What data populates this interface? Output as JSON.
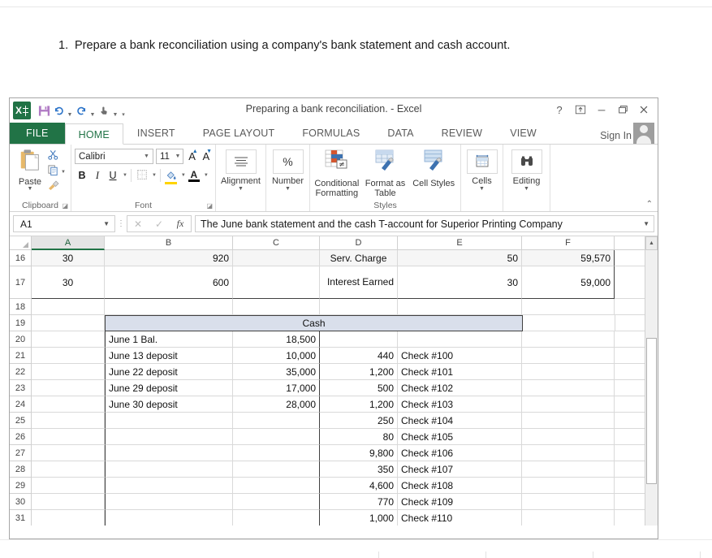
{
  "prompt": {
    "number": "1.",
    "text": "Prepare a bank reconciliation using a company's bank statement and cash account."
  },
  "window": {
    "title": "Preparing a bank reconciliation. - Excel",
    "help_icon": "?",
    "ribbon_display_icon": "ribbon-display-options-icon",
    "minimize_icon": "minimize-icon",
    "restore_icon": "restore-icon",
    "close_icon": "close-icon",
    "signin": "Sign In",
    "accent_green": "#217346"
  },
  "qat": {
    "logo": "excel-logo-icon",
    "save": "save-icon",
    "undo": "undo-icon",
    "redo": "redo-icon",
    "touch": "touch-mode-icon",
    "customize": "customize-quick-access-toolbar-icon"
  },
  "tabs": [
    {
      "label": "FILE",
      "active": false,
      "file": true
    },
    {
      "label": "HOME",
      "active": true,
      "file": false
    },
    {
      "label": "INSERT",
      "active": false,
      "file": false
    },
    {
      "label": "PAGE LAYOUT",
      "active": false,
      "file": false
    },
    {
      "label": "FORMULAS",
      "active": false,
      "file": false
    },
    {
      "label": "DATA",
      "active": false,
      "file": false
    },
    {
      "label": "REVIEW",
      "active": false,
      "file": false
    },
    {
      "label": "VIEW",
      "active": false,
      "file": false
    }
  ],
  "ribbon": {
    "clipboard": {
      "group_label": "Clipboard",
      "paste_label": "Paste",
      "cut_icon": "cut-scissors-icon",
      "copy_icon": "copy-icon",
      "format_painter_icon": "format-painter-icon",
      "dialog_launcher": "dialog-box-launcher-icon"
    },
    "font": {
      "group_label": "Font",
      "font_name": "Calibri",
      "font_size": "11",
      "grow_font": "A",
      "shrink_font": "A",
      "bold": "B",
      "italic": "I",
      "underline": "U",
      "borders_icon": "borders-icon",
      "fill_color_icon": "fill-color-icon",
      "font_color_icon": "font-color-icon",
      "dialog_launcher": "dialog-box-launcher-icon"
    },
    "alignment": {
      "label": "Alignment",
      "icon": "alignment-icon"
    },
    "number": {
      "label": "Number",
      "icon": "percent-icon"
    },
    "styles": {
      "group_label": "Styles",
      "items": [
        {
          "label": "Conditional Formatting",
          "icon": "conditional-formatting-icon"
        },
        {
          "label": "Format as Table",
          "icon": "format-as-table-icon"
        },
        {
          "label": "Cell Styles",
          "icon": "cell-styles-icon"
        }
      ]
    },
    "cells": {
      "label": "Cells",
      "icon": "cells-icon"
    },
    "editing": {
      "label": "Editing",
      "icon": "editing-binoculars-icon"
    },
    "collapse_icon": "collapse-ribbon-icon"
  },
  "formula_bar": {
    "name_box": "A1",
    "cancel_icon": "cancel-x-icon",
    "enter_icon": "enter-check-icon",
    "insert_function_icon": "fx",
    "formula": "The June bank statement and the cash T-account for Superior Printing Company",
    "expand_icon": "expand-formula-bar-icon"
  },
  "sheet": {
    "columns": [
      "A",
      "B",
      "C",
      "D",
      "E",
      "F",
      ""
    ],
    "selected_column": "A",
    "rows": [
      {
        "num": "16",
        "shaded": true,
        "cells": [
          {
            "col": "A",
            "value": "30",
            "align": "ctr"
          },
          {
            "col": "B",
            "value": "920",
            "align": "rgt"
          },
          {
            "col": "C",
            "value": "",
            "align": "lft"
          },
          {
            "col": "D",
            "value": "Serv. Charge",
            "align": "ctr"
          },
          {
            "col": "E",
            "value": "50",
            "align": "rgt"
          },
          {
            "col": "F",
            "value": "59,570",
            "align": "rgt"
          },
          {
            "col": "G",
            "value": "",
            "align": "lft"
          }
        ]
      },
      {
        "num": "17",
        "shaded": false,
        "cells": [
          {
            "col": "A",
            "value": "30",
            "align": "ctr"
          },
          {
            "col": "B",
            "value": "600",
            "align": "rgt"
          },
          {
            "col": "C",
            "value": "",
            "align": "lft"
          },
          {
            "col": "D",
            "value": "Interest Earned",
            "align": "wrap"
          },
          {
            "col": "E",
            "value": "30",
            "align": "rgt"
          },
          {
            "col": "F",
            "value": "59,000",
            "align": "rgt"
          },
          {
            "col": "G",
            "value": "",
            "align": "lft"
          }
        ]
      },
      {
        "num": "18",
        "shaded": false,
        "cells": [
          {
            "col": "A",
            "value": "",
            "align": "lft"
          },
          {
            "col": "B",
            "value": "",
            "align": "lft"
          },
          {
            "col": "C",
            "value": "",
            "align": "lft"
          },
          {
            "col": "D",
            "value": "",
            "align": "lft"
          },
          {
            "col": "E",
            "value": "",
            "align": "lft"
          },
          {
            "col": "F",
            "value": "",
            "align": "lft"
          },
          {
            "col": "G",
            "value": "",
            "align": "lft"
          }
        ]
      },
      {
        "num": "19",
        "shaded": false,
        "merged_label": "Cash",
        "cells": []
      },
      {
        "num": "20",
        "shaded": false,
        "cells": [
          {
            "col": "A",
            "value": "",
            "align": "lft"
          },
          {
            "col": "B",
            "value": "June 1 Bal.",
            "align": "lft"
          },
          {
            "col": "C",
            "value": "18,500",
            "align": "rgt"
          },
          {
            "col": "D",
            "value": "",
            "align": "rgt"
          },
          {
            "col": "E",
            "value": "",
            "align": "lft"
          },
          {
            "col": "F",
            "value": "",
            "align": "lft"
          },
          {
            "col": "G",
            "value": "",
            "align": "lft"
          }
        ]
      },
      {
        "num": "21",
        "shaded": false,
        "cells": [
          {
            "col": "A",
            "value": "",
            "align": "lft"
          },
          {
            "col": "B",
            "value": "June 13 deposit",
            "align": "lft"
          },
          {
            "col": "C",
            "value": "10,000",
            "align": "rgt"
          },
          {
            "col": "D",
            "value": "440",
            "align": "rgt"
          },
          {
            "col": "E",
            "value": "Check #100",
            "align": "lft"
          },
          {
            "col": "F",
            "value": "",
            "align": "lft"
          },
          {
            "col": "G",
            "value": "",
            "align": "lft"
          }
        ]
      },
      {
        "num": "22",
        "shaded": false,
        "cells": [
          {
            "col": "A",
            "value": "",
            "align": "lft"
          },
          {
            "col": "B",
            "value": "June 22 deposit",
            "align": "lft"
          },
          {
            "col": "C",
            "value": "35,000",
            "align": "rgt"
          },
          {
            "col": "D",
            "value": "1,200",
            "align": "rgt"
          },
          {
            "col": "E",
            "value": "Check #101",
            "align": "lft"
          },
          {
            "col": "F",
            "value": "",
            "align": "lft"
          },
          {
            "col": "G",
            "value": "",
            "align": "lft"
          }
        ]
      },
      {
        "num": "23",
        "shaded": false,
        "cells": [
          {
            "col": "A",
            "value": "",
            "align": "lft"
          },
          {
            "col": "B",
            "value": "June 29 deposit",
            "align": "lft"
          },
          {
            "col": "C",
            "value": "17,000",
            "align": "rgt"
          },
          {
            "col": "D",
            "value": "500",
            "align": "rgt"
          },
          {
            "col": "E",
            "value": "Check #102",
            "align": "lft"
          },
          {
            "col": "F",
            "value": "",
            "align": "lft"
          },
          {
            "col": "G",
            "value": "",
            "align": "lft"
          }
        ]
      },
      {
        "num": "24",
        "shaded": false,
        "cells": [
          {
            "col": "A",
            "value": "",
            "align": "lft"
          },
          {
            "col": "B",
            "value": "June 30 deposit",
            "align": "lft"
          },
          {
            "col": "C",
            "value": "28,000",
            "align": "rgt"
          },
          {
            "col": "D",
            "value": "1,200",
            "align": "rgt"
          },
          {
            "col": "E",
            "value": "Check #103",
            "align": "lft"
          },
          {
            "col": "F",
            "value": "",
            "align": "lft"
          },
          {
            "col": "G",
            "value": "",
            "align": "lft"
          }
        ]
      },
      {
        "num": "25",
        "shaded": false,
        "cells": [
          {
            "col": "A",
            "value": "",
            "align": "lft"
          },
          {
            "col": "B",
            "value": "",
            "align": "lft"
          },
          {
            "col": "C",
            "value": "",
            "align": "rgt"
          },
          {
            "col": "D",
            "value": "250",
            "align": "rgt"
          },
          {
            "col": "E",
            "value": "Check #104",
            "align": "lft"
          },
          {
            "col": "F",
            "value": "",
            "align": "lft"
          },
          {
            "col": "G",
            "value": "",
            "align": "lft"
          }
        ]
      },
      {
        "num": "26",
        "shaded": false,
        "cells": [
          {
            "col": "A",
            "value": "",
            "align": "lft"
          },
          {
            "col": "B",
            "value": "",
            "align": "lft"
          },
          {
            "col": "C",
            "value": "",
            "align": "rgt"
          },
          {
            "col": "D",
            "value": "80",
            "align": "rgt"
          },
          {
            "col": "E",
            "value": "Check #105",
            "align": "lft"
          },
          {
            "col": "F",
            "value": "",
            "align": "lft"
          },
          {
            "col": "G",
            "value": "",
            "align": "lft"
          }
        ]
      },
      {
        "num": "27",
        "shaded": false,
        "cells": [
          {
            "col": "A",
            "value": "",
            "align": "lft"
          },
          {
            "col": "B",
            "value": "",
            "align": "lft"
          },
          {
            "col": "C",
            "value": "",
            "align": "rgt"
          },
          {
            "col": "D",
            "value": "9,800",
            "align": "rgt"
          },
          {
            "col": "E",
            "value": "Check #106",
            "align": "lft"
          },
          {
            "col": "F",
            "value": "",
            "align": "lft"
          },
          {
            "col": "G",
            "value": "",
            "align": "lft"
          }
        ]
      },
      {
        "num": "28",
        "shaded": false,
        "cells": [
          {
            "col": "A",
            "value": "",
            "align": "lft"
          },
          {
            "col": "B",
            "value": "",
            "align": "lft"
          },
          {
            "col": "C",
            "value": "",
            "align": "rgt"
          },
          {
            "col": "D",
            "value": "350",
            "align": "rgt"
          },
          {
            "col": "E",
            "value": "Check #107",
            "align": "lft"
          },
          {
            "col": "F",
            "value": "",
            "align": "lft"
          },
          {
            "col": "G",
            "value": "",
            "align": "lft"
          }
        ]
      },
      {
        "num": "29",
        "shaded": false,
        "cells": [
          {
            "col": "A",
            "value": "",
            "align": "lft"
          },
          {
            "col": "B",
            "value": "",
            "align": "lft"
          },
          {
            "col": "C",
            "value": "",
            "align": "rgt"
          },
          {
            "col": "D",
            "value": "4,600",
            "align": "rgt"
          },
          {
            "col": "E",
            "value": "Check #108",
            "align": "lft"
          },
          {
            "col": "F",
            "value": "",
            "align": "lft"
          },
          {
            "col": "G",
            "value": "",
            "align": "lft"
          }
        ]
      },
      {
        "num": "30",
        "shaded": false,
        "cells": [
          {
            "col": "A",
            "value": "",
            "align": "lft"
          },
          {
            "col": "B",
            "value": "",
            "align": "lft"
          },
          {
            "col": "C",
            "value": "",
            "align": "rgt"
          },
          {
            "col": "D",
            "value": "770",
            "align": "rgt"
          },
          {
            "col": "E",
            "value": "Check #109",
            "align": "lft"
          },
          {
            "col": "F",
            "value": "",
            "align": "lft"
          },
          {
            "col": "G",
            "value": "",
            "align": "lft"
          }
        ]
      },
      {
        "num": "31",
        "shaded": false,
        "clipped": true,
        "cells": [
          {
            "col": "A",
            "value": "",
            "align": "lft"
          },
          {
            "col": "B",
            "value": "",
            "align": "lft"
          },
          {
            "col": "C",
            "value": "",
            "align": "rgt"
          },
          {
            "col": "D",
            "value": "1,000",
            "align": "rgt"
          },
          {
            "col": "E",
            "value": "Check #110",
            "align": "lft"
          },
          {
            "col": "F",
            "value": "",
            "align": "lft"
          },
          {
            "col": "G",
            "value": "",
            "align": "lft"
          }
        ]
      }
    ]
  }
}
